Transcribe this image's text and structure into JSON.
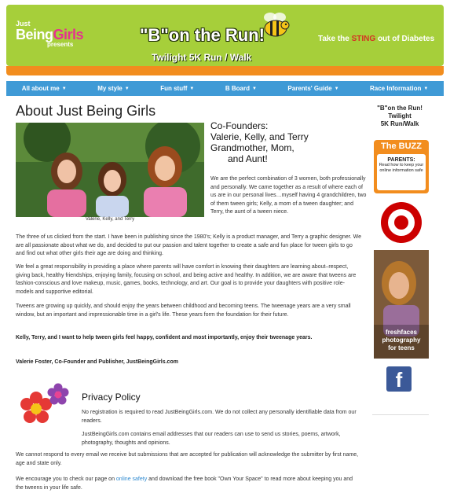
{
  "header": {
    "logo_line1": "Just",
    "logo_line2_a": "Being",
    "logo_line2_b": "Girls",
    "logo_presents": "presents",
    "event_title": "\"B\"on the Run!",
    "event_subtitle": "Twilight 5K Run / Walk",
    "tagline_a": "Take the ",
    "tagline_sting": "STING",
    "tagline_b": " out of Diabetes"
  },
  "nav": {
    "items": [
      {
        "label": "All about me"
      },
      {
        "label": "My style"
      },
      {
        "label": "Fun stuff"
      },
      {
        "label": "B Board"
      },
      {
        "label": "Parents' Guide"
      },
      {
        "label": "Race Information"
      }
    ]
  },
  "main": {
    "title": "About Just Being Girls",
    "photo_caption": "Valerie, Kelly, and Terry",
    "cofounders_l1": "Co-Founders:",
    "cofounders_l2": "Valerie, Kelly, and Terry",
    "cofounders_l3": "Grandmother, Mom,",
    "cofounders_l4": "and Aunt!",
    "p1": "We are the perfect combination of 3 women, both professionally and personally. We came together as a result of where each of us are in our personal lives…myself having 4 grandchildren, two of them tween girls;  Kelly, a mom of a tween daughter; and Terry, the aunt of a tween niece.",
    "p2": "The three of us clicked from the start. I have been in publishing since the 1980's; Kelly is a product manager, and Terry a graphic designer. We are all passionate about what we do, and decided to put our passion and talent together to create a safe and fun place for tween girls to go and find out what other girls their age are doing and thinking.",
    "p3": "We feel a great responsibility in providing a place where parents will have comfort in knowing their daughters are learning about–respect, giving back, healthy friendships, enjoying family, focusing on school, and being active and healthy. In addition, we are aware that tweens are fashion-conscious and love makeup, music, games, books, technology, and art. Our goal is to provide your daughters with positive role-models and supportive editorial.",
    "p4": "Tweens are growing up quickly, and should enjoy the years between childhood and becoming teens. The tweenage years are a very small window, but an important and impressionable time in a girl's life. These years form the foundation for their future.",
    "p5": "Kelly, Terry, and I want to help tween girls feel happy, confident and most importantly, enjoy their tweenage years.",
    "signature": "Valerie Foster, Co-Founder and Publisher, JustBeingGirls.com"
  },
  "privacy": {
    "title": "Privacy Policy",
    "p1": "No registration is required to read JustBeingGirls.com. We do not collect any personally identifiable data from our readers.",
    "p2": "JustBeingGirls.com contains email addresses that our readers can use to send us stories, poems, artwork, photography, thoughts and opinions.",
    "p3": "We cannot respond to every email we receive but submissions that are accepted for publication will acknowledge the submitter by first name, age and state only.",
    "p4_a": "We encourage you to check our page on ",
    "p4_link": "online safety",
    "p4_b": " and download the free book \"Own Your Space\" to read more about keeping you and the tweens in your life safe."
  },
  "sidebar": {
    "bee_l1": "\"B\"on the Run!",
    "bee_l2": "Twilight",
    "bee_l3": "5K Run/Walk",
    "buzz_title": "The BUZZ",
    "buzz_heading": "PARENTS:",
    "buzz_text": "Read how to keep your online information safe",
    "fresh_l1": "freshfaces",
    "fresh_l2": "photography",
    "fresh_l3": "for teens",
    "facebook": "f"
  },
  "colors": {
    "header_green": "#a6cf3a",
    "header_orange": "#f28d1e",
    "nav_blue": "#3f9ad6",
    "link_blue": "#2f8ad0",
    "sting_red": "#d43323"
  }
}
